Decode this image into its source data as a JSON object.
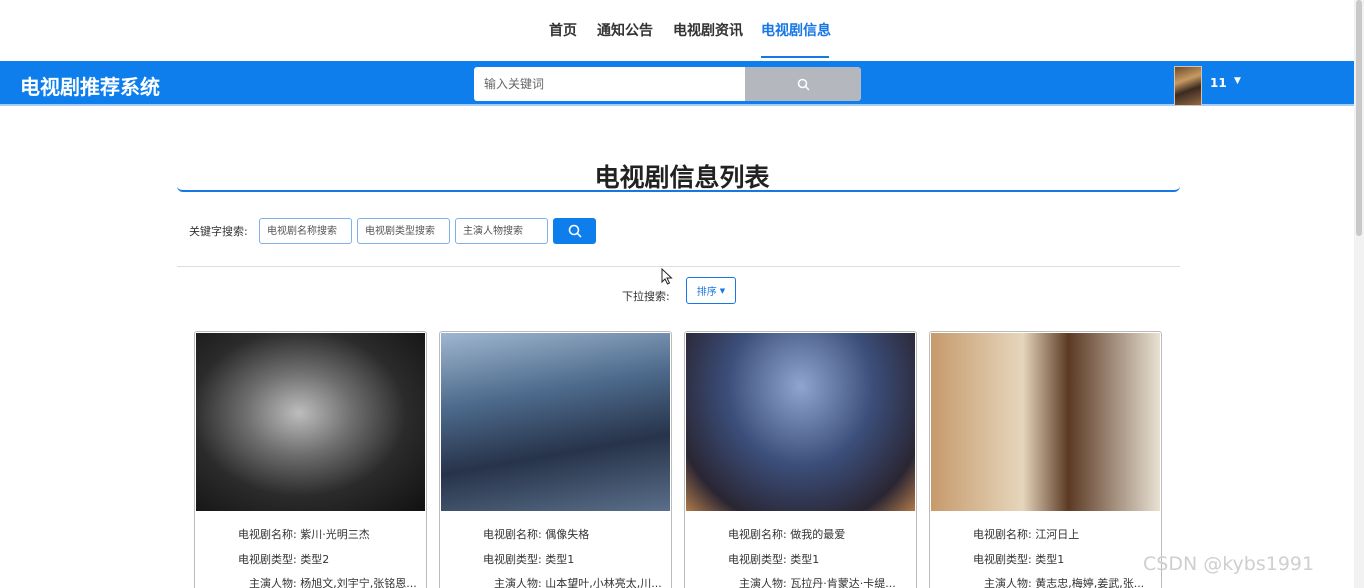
{
  "nav": {
    "items": [
      {
        "label": "首页"
      },
      {
        "label": "通知公告"
      },
      {
        "label": "电视剧资讯"
      },
      {
        "label": "电视剧信息",
        "active": true
      }
    ]
  },
  "header": {
    "brand": "电视剧推荐系统",
    "search_placeholder": "输入关键词",
    "username": "11",
    "caret": "▼"
  },
  "page_title": "电视剧信息列表",
  "filters": {
    "keyword_label": "关键字搜索:",
    "name_placeholder": "电视剧名称搜索",
    "type_placeholder": "电视剧类型搜索",
    "actor_placeholder": "主演人物搜索",
    "dropdown_label": "下拉搜索:",
    "sort_label": "排序"
  },
  "cards": [
    {
      "name": "电视剧名称: 紫川·光明三杰",
      "type": "电视剧类型: 类型2",
      "actors": "主演人物: 杨旭文,刘宇宁,张铭恩..."
    },
    {
      "name": "电视剧名称: 偶像失格",
      "type": "电视剧类型: 类型1",
      "actors": "主演人物: 山本望叶,小林亮太,川..."
    },
    {
      "name": "电视剧名称: 做我的最爱",
      "type": "电视剧类型: 类型1",
      "actors": "主演人物: 瓦拉丹·肯蒙达·卡缇..."
    },
    {
      "name": "电视剧名称: 江河日上",
      "type": "电视剧类型: 类型1",
      "actors": "主演人物: 黄志忠,梅婷,姜武,张..."
    }
  ],
  "watermark": "CSDN @kybs1991",
  "colors": {
    "primary": "#0e7eed",
    "active_nav": "#1677e5"
  },
  "icons": [
    "search-icon",
    "chevron-down-icon",
    "mouse-cursor-icon"
  ]
}
